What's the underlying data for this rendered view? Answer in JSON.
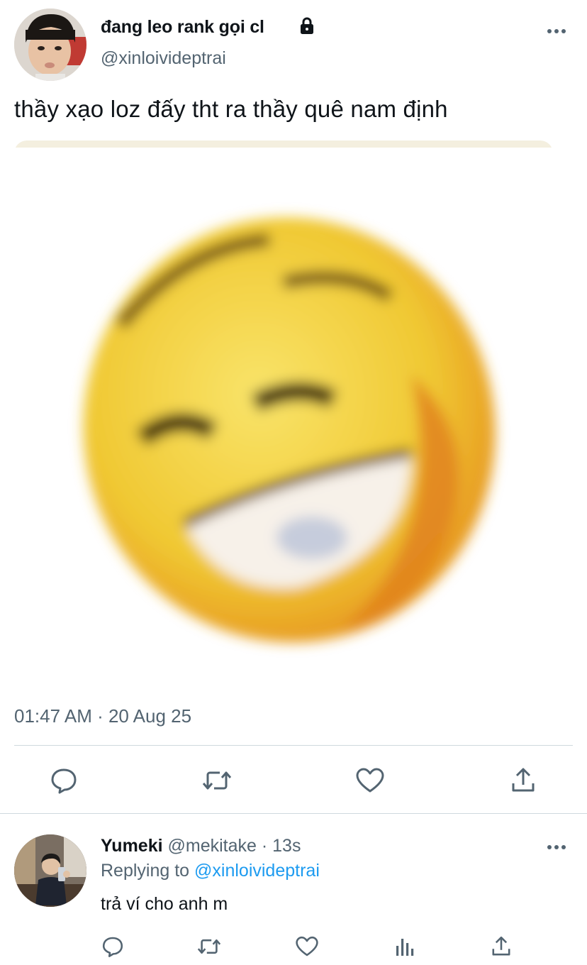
{
  "tweet": {
    "display_name": "đang leo rank gọi cl",
    "handle": "@xinloivideptrai",
    "text": "thầy xạo loz đấy tht ra thầy quê nam định",
    "timestamp": "01:47 AM · 20 Aug 25",
    "media_icon": "blurry-laughing-emoji",
    "actions": [
      "reply-icon",
      "retweet-icon",
      "like-icon",
      "share-icon"
    ]
  },
  "reply": {
    "display_name": "Yumeki",
    "meta": "@mekitake · 13s",
    "replying_prefix": "Replying to",
    "replying_mention": "@xinloivideptrai",
    "text": "trả ví cho anh m",
    "actions": [
      "reply-icon",
      "retweet-icon",
      "like-icon",
      "analytics-icon",
      "share-icon"
    ]
  },
  "colors": {
    "text_primary": "#0f1419",
    "text_secondary": "#536471",
    "link": "#1d9bf0",
    "divider": "#cfd9de",
    "emoji_yellow": "#f3d23a"
  }
}
